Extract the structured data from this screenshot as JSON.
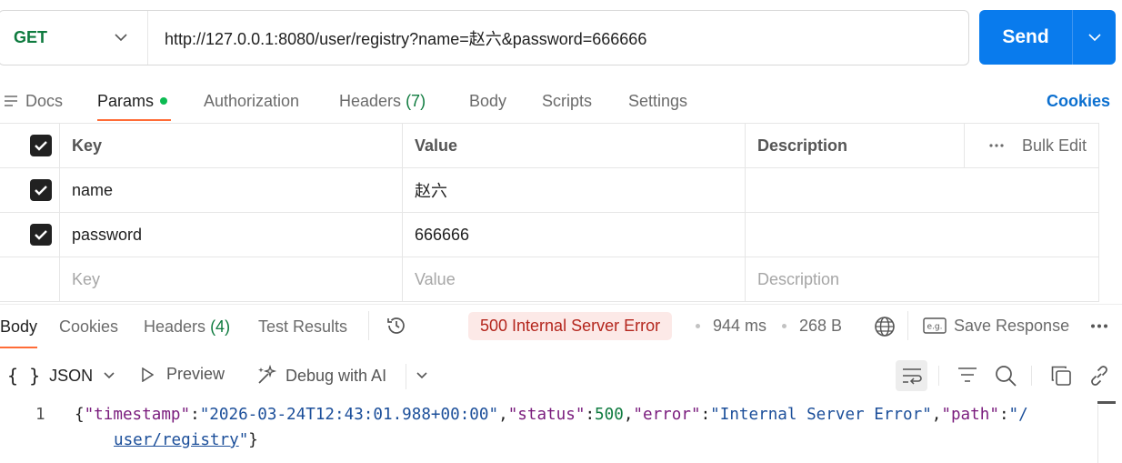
{
  "request": {
    "method": "GET",
    "url": "http://127.0.0.1:8080/user/registry?name=赵六&password=666666",
    "send_label": "Send"
  },
  "request_tabs": {
    "docs": "Docs",
    "params": "Params",
    "authorization": "Authorization",
    "headers": "Headers",
    "headers_count": "(7)",
    "body": "Body",
    "scripts": "Scripts",
    "settings": "Settings",
    "cookies": "Cookies"
  },
  "params": {
    "headers": {
      "key": "Key",
      "value": "Value",
      "description": "Description",
      "bulk_edit": "Bulk Edit"
    },
    "rows": [
      {
        "key": "name",
        "value": "赵六",
        "description": "",
        "checked": true
      },
      {
        "key": "password",
        "value": "666666",
        "description": "",
        "checked": true
      }
    ],
    "placeholder": {
      "key": "Key",
      "value": "Value",
      "description": "Description"
    }
  },
  "response_tabs": {
    "body": "Body",
    "cookies": "Cookies",
    "headers": "Headers",
    "headers_count": "(4)",
    "test_results": "Test Results"
  },
  "response_meta": {
    "status": "500 Internal Server Error",
    "time": "944 ms",
    "size": "268 B",
    "save_response": "Save Response"
  },
  "response_toolbar": {
    "format": "JSON",
    "preview": "Preview",
    "debug": "Debug with AI"
  },
  "response_body": {
    "line_number": "1",
    "line1_prefix": "{",
    "timestamp_key": "\"timestamp\"",
    "timestamp_value": "\"2026-03-24T12:43:01.988+00:00\"",
    "status_key": "\"status\"",
    "status_value": "500",
    "error_key": "\"error\"",
    "error_value": "\"Internal Server Error\"",
    "path_key": "\"path\"",
    "path_value_start": "\"/",
    "path_value_rest": "user/registry",
    "path_value_end": "\"",
    "closing": "}"
  },
  "colors": {
    "send_button": "#097bed",
    "method_get": "#0f7b3f",
    "tab_underline": "#ff6c37",
    "error_badge_bg": "#fce9e7",
    "error_badge_text": "#b4261d",
    "cookies_link": "#0b6fcf"
  },
  "icons": {
    "method_dropdown": "chevron-down-icon",
    "send_dropdown": "chevron-down-icon",
    "docs": "docs-lines-icon",
    "history": "history-icon",
    "globe": "globe-icon",
    "save": "eg-save-icon",
    "more": "more-horizontal-icon",
    "format": "braces-icon",
    "preview": "play-icon",
    "debug": "ai-sparkle-icon",
    "wrap": "wrap-lines-icon",
    "filter": "filter-icon",
    "search": "search-icon",
    "copy": "copy-icon",
    "link": "link-icon"
  }
}
